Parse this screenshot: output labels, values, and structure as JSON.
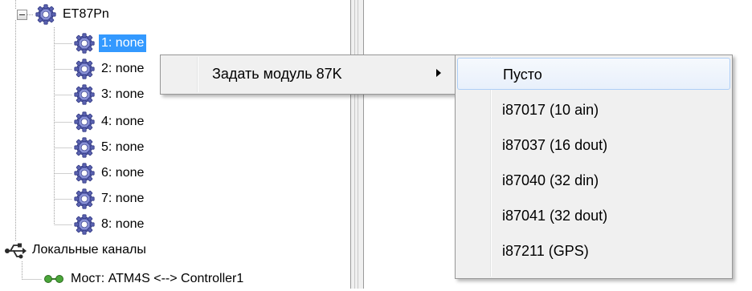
{
  "tree": {
    "root_label": "ET87Pn",
    "modules": [
      "1: none",
      "2: none",
      "3: none",
      "4: none",
      "5: none",
      "6: none",
      "7: none",
      "8: none"
    ],
    "local_channels_label": "Локальные каналы",
    "bridge_label": "Мост: ATM4S <--> Controller1"
  },
  "context_menu": {
    "set_module_label": "Задать модуль 87K"
  },
  "submenu": {
    "items": [
      "Пусто",
      "i87017 (10 ain)",
      "i87037 (16 dout)",
      "i87040 (32 din)",
      "i87041 (32 dout)",
      "i87211 (GPS)"
    ]
  },
  "colors": {
    "selection": "#3399ff",
    "gear": "#5a62b0",
    "gear_dark": "#3a4190",
    "menu_bg": "#f0f0f0"
  },
  "icons": {
    "module": "gear-icon",
    "local_channels": "usb-icon",
    "bridge": "link-icon",
    "expander": "minus-box-icon",
    "submenu_arrow": "submenu-arrow-icon"
  }
}
